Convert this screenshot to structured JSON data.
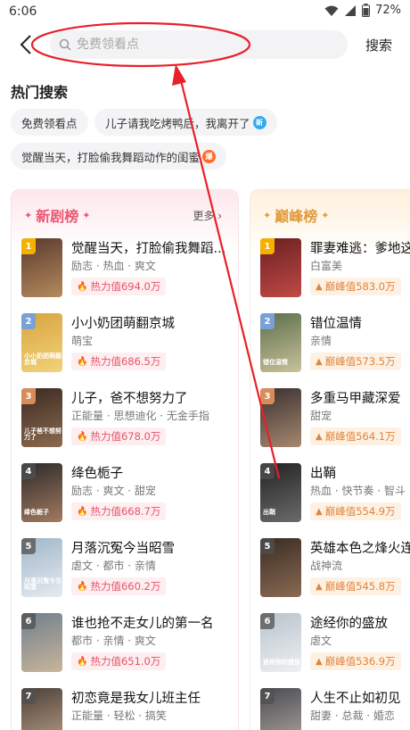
{
  "status_bar": {
    "time": "6:06",
    "battery": "72%"
  },
  "header": {
    "search_placeholder": "免费领看点",
    "search_label": "搜索"
  },
  "hot_search": {
    "title": "热门搜索",
    "chips": [
      {
        "text": "免费领看点",
        "badge": ""
      },
      {
        "text": "儿子请我吃烤鸭后，我离开了",
        "badge": "新"
      },
      {
        "text": "觉醒当天，打脸偷我舞蹈动作的闺蜜",
        "badge": "爆"
      }
    ]
  },
  "rank_new": {
    "title": "新剧榜",
    "more": "更多",
    "items": [
      {
        "rank": "1",
        "title": "觉醒当天，打脸偷我舞蹈...",
        "tags": "励志 · 热血 · 爽文",
        "score": "热力值694.0万",
        "cover": [
          "#5a3a2e",
          "#b48a5c"
        ],
        "cover_text": ""
      },
      {
        "rank": "2",
        "title": "小小奶团萌翻京城",
        "tags": "萌宝",
        "score": "热力值686.5万",
        "cover": [
          "#d9a441",
          "#f1d27a"
        ],
        "cover_text": "小小奶团萌翻京城"
      },
      {
        "rank": "3",
        "title": "儿子，爸不想努力了",
        "tags": "正能量 · 思想迪化 · 无金手指",
        "score": "热力值678.0万",
        "cover": [
          "#3b2a22",
          "#8c6a4f"
        ],
        "cover_text": "儿子爸不想努力了"
      },
      {
        "rank": "4",
        "title": "绛色栀子",
        "tags": "励志 · 爽文 · 甜宠",
        "score": "热力值668.7万",
        "cover": [
          "#2c2a2a",
          "#a37a60"
        ],
        "cover_text": "绛色栀子"
      },
      {
        "rank": "5",
        "title": "月落沉冤今当昭雪",
        "tags": "虐文 · 都市 · 亲情",
        "score": "热力值660.2万",
        "cover": [
          "#9fb6c9",
          "#e6ebf0"
        ],
        "cover_text": "月落沉冤今当昭雪"
      },
      {
        "rank": "6",
        "title": "谁也抢不走女儿的第一名",
        "tags": "都市 · 亲情 · 爽文",
        "score": "热力值651.0万",
        "cover": [
          "#6f7f8d",
          "#c9b59a"
        ],
        "cover_text": ""
      },
      {
        "rank": "7",
        "title": "初恋竟是我女儿班主任",
        "tags": "正能量 · 轻松 · 搞笑",
        "score": "",
        "cover": [
          "#4b4038",
          "#bba088"
        ],
        "cover_text": ""
      }
    ]
  },
  "rank_peak": {
    "title": "巅峰榜",
    "items": [
      {
        "rank": "1",
        "title": "罪妻难逃：爹地这",
        "tags": "白富美",
        "score": "巅峰值583.0万",
        "cover": [
          "#6a1f22",
          "#c04a45"
        ],
        "cover_text": ""
      },
      {
        "rank": "2",
        "title": "错位温情",
        "tags": "亲情",
        "score": "巅峰值573.5万",
        "cover": [
          "#5b6e4c",
          "#c9c29a"
        ],
        "cover_text": "错位温情"
      },
      {
        "rank": "3",
        "title": "多重马甲藏深爱",
        "tags": "甜宠",
        "score": "巅峰值564.1万",
        "cover": [
          "#3a3030",
          "#a58870"
        ],
        "cover_text": ""
      },
      {
        "rank": "4",
        "title": "出鞘",
        "tags": "热血 · 快节奏 · 智斗",
        "score": "巅峰值554.9万",
        "cover": [
          "#222222",
          "#6b6b6b"
        ],
        "cover_text": "出鞘"
      },
      {
        "rank": "5",
        "title": "英雄本色之烽火连",
        "tags": "战神流",
        "score": "巅峰值545.8万",
        "cover": [
          "#3a2c24",
          "#8a6a52"
        ],
        "cover_text": ""
      },
      {
        "rank": "6",
        "title": "途经你的盛放",
        "tags": "虐文",
        "score": "巅峰值536.9万",
        "cover": [
          "#b8c2cc",
          "#eef0f2"
        ],
        "cover_text": "途经你的盛放"
      },
      {
        "rank": "7",
        "title": "人生不止如初见",
        "tags": "甜妻 · 总裁 · 婚恋",
        "score": "",
        "cover": [
          "#4a4a52",
          "#b0a8a0"
        ],
        "cover_text": ""
      }
    ]
  },
  "annotation_color": "#e8202a"
}
